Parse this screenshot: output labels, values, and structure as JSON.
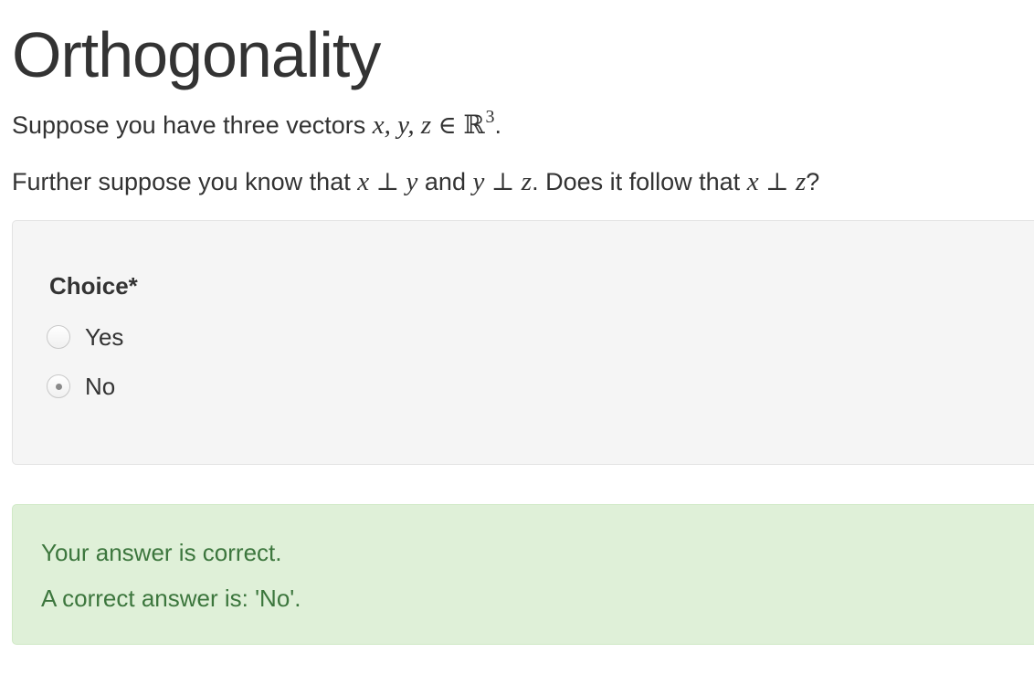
{
  "page": {
    "title": "Orthogonality"
  },
  "question": {
    "line1_text": "Suppose you have three vectors ",
    "line1_math_vars": "x, y, z",
    "line1_math_in": "∈",
    "line1_math_set": "ℝ",
    "line1_math_exp": "3",
    "line1_end": ".",
    "line2_text_a": "Further suppose you know that ",
    "line2_math_a": "x",
    "line2_perp": "⊥",
    "line2_math_b": "y",
    "line2_text_b": " and ",
    "line2_math_c": "y",
    "line2_math_d": "z",
    "line2_text_c": ". Does it follow that ",
    "line2_math_e": "x",
    "line2_math_f": "z",
    "line2_end": "?"
  },
  "form": {
    "choice_label": "Choice*",
    "options": [
      {
        "label": "Yes",
        "checked": false
      },
      {
        "label": "No",
        "checked": true
      }
    ]
  },
  "feedback": {
    "status": "Your answer is correct.",
    "answer": "A correct answer is: 'No'.",
    "color": "#3c763d",
    "background": "#dff0d8"
  }
}
